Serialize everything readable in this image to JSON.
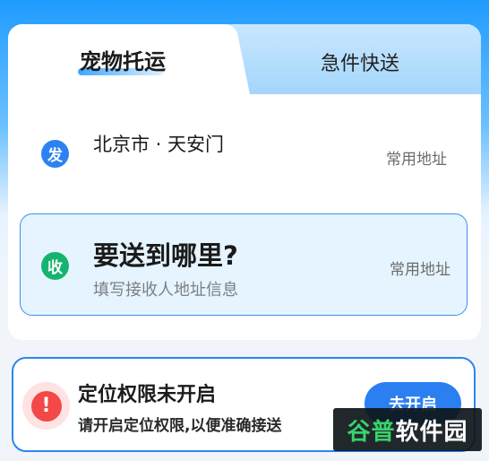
{
  "tabs": [
    {
      "label": "宠物托运",
      "active": true
    },
    {
      "label": "急件快送",
      "active": false
    }
  ],
  "sender": {
    "badge": "发",
    "address": "北京市 · 天安门",
    "common_address": "常用地址"
  },
  "receiver": {
    "badge": "收",
    "title": "要送到哪里?",
    "subtitle": "填写接收人地址信息",
    "common_address": "常用地址"
  },
  "permission": {
    "icon": "!",
    "title": "定位权限未开启",
    "description": "请开启定位权限,以便准确接送",
    "button_label": "去开启"
  },
  "watermark": {
    "part1": "谷普",
    "part2": "软件园"
  },
  "colors": {
    "accent_blue": "#2c7ff0",
    "receive_green": "#15b46e",
    "warning_red": "#f24848"
  }
}
